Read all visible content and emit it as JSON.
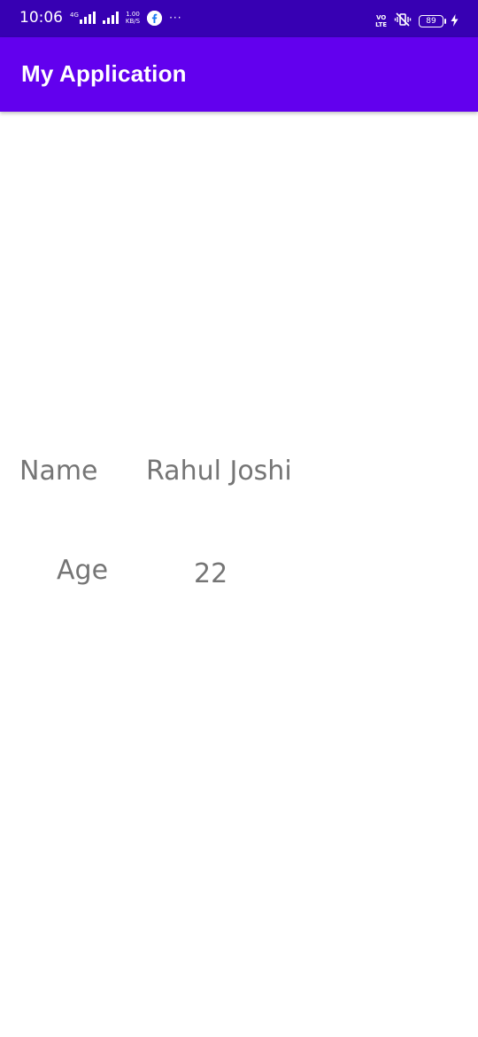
{
  "status_bar": {
    "time": "10:06",
    "network_type": "4G",
    "speed_value": "1.00",
    "speed_unit": "KB/S",
    "more": "···",
    "volte_top": "VO",
    "volte_bottom": "LTE",
    "battery_level": "89",
    "icons": [
      "signal-4g-icon",
      "signal-icon",
      "facebook-icon",
      "more-notifications-icon",
      "volte-icon",
      "vibrate-icon",
      "battery-icon",
      "charging-icon"
    ]
  },
  "app_bar": {
    "title": "My Application",
    "background": "#6200EE"
  },
  "content": {
    "name_label": "Name",
    "name_value": "Rahul Joshi",
    "age_label": "Age",
    "age_value": "22"
  },
  "colors": {
    "status_bar": "#3700B3",
    "app_bar": "#6200EE",
    "text": "#757575",
    "background": "#FFFFFF"
  }
}
